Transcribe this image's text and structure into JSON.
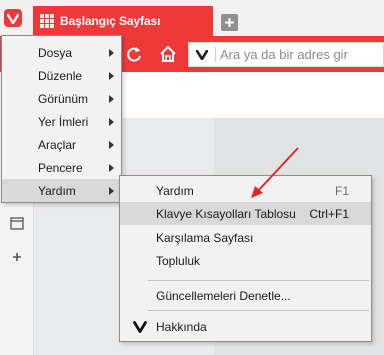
{
  "tab": {
    "title": "Başlangıç Sayfası"
  },
  "address_bar": {
    "placeholder": "Ara ya da bir adres gir"
  },
  "main_menu": {
    "items": [
      {
        "label": "Dosya"
      },
      {
        "label": "Düzenle"
      },
      {
        "label": "Görünüm"
      },
      {
        "label": "Yer İmleri"
      },
      {
        "label": "Araçlar"
      },
      {
        "label": "Pencere"
      },
      {
        "label": "Yardım"
      }
    ]
  },
  "help_menu": {
    "help": {
      "label": "Yardım",
      "shortcut": "F1"
    },
    "keyboard": {
      "label": "Klavye Kısayolları Tablosu",
      "shortcut": "Ctrl+F1"
    },
    "welcome": {
      "label": "Karşılama Sayfası"
    },
    "community": {
      "label": "Topluluk"
    },
    "updates": {
      "label": "Güncellemeleri Denetle..."
    },
    "about": {
      "label": "Hakkında"
    }
  },
  "colors": {
    "brand_red": "#ef3939",
    "annotation_red": "#e5262b",
    "menu_bg": "#f2f2f2",
    "hover_bg": "#d9d9d9"
  },
  "icons": {
    "vivaldi_logo": "vivaldi-v",
    "new_tab": "plus",
    "reload": "reload",
    "home": "home",
    "panel_window": "window",
    "panel_add": "plus"
  }
}
